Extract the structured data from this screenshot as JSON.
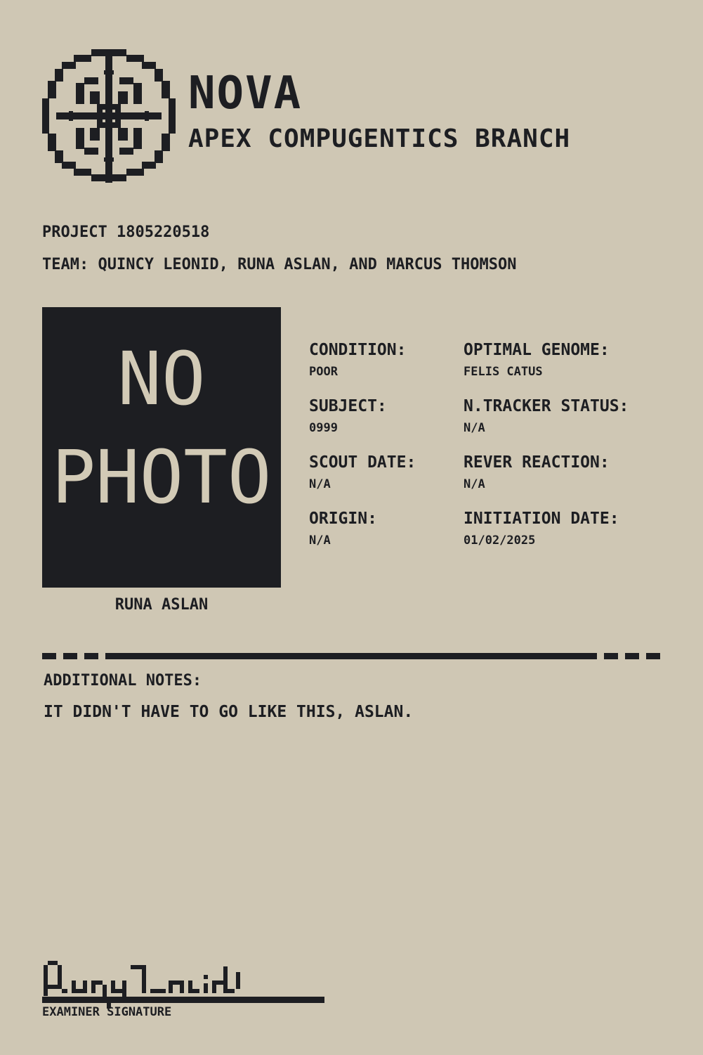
{
  "header": {
    "logo_icon": "compass-crosshair-icon",
    "title": "NOVA",
    "subtitle": "APEX COMPUGENTICS BRANCH"
  },
  "project": {
    "line": "PROJECT 1805220518",
    "team": "TEAM: QUINCY LEONID, RUNA ASLAN, AND MARCUS THOMSON"
  },
  "photo": {
    "line1": "NO",
    "line2": "PHOTO",
    "caption": "RUNA ASLAN"
  },
  "fields": [
    {
      "label": "CONDITION:",
      "value": "POOR"
    },
    {
      "label": "OPTIMAL GENOME:",
      "value": "FELIS CATUS"
    },
    {
      "label": "SUBJECT:",
      "value": "0999"
    },
    {
      "label": "N.TRACKER STATUS:",
      "value": "N/A"
    },
    {
      "label": "SCOUT DATE:",
      "value": "N/A"
    },
    {
      "label": "REVER REACTION:",
      "value": "N/A"
    },
    {
      "label": "ORIGIN:",
      "value": "N/A"
    },
    {
      "label": "INITIATION DATE:",
      "value": "01/02/2025"
    }
  ],
  "notes": {
    "label": "ADDITIONAL NOTES:",
    "text": "IT DIDN'T HAVE TO GO LIKE THIS, ASLAN."
  },
  "signature": {
    "caption": "EXAMINER SIGNATURE"
  },
  "colors": {
    "paper": "#cfc7b4",
    "ink": "#1d1e22",
    "photo_text": "#d2cab6"
  }
}
